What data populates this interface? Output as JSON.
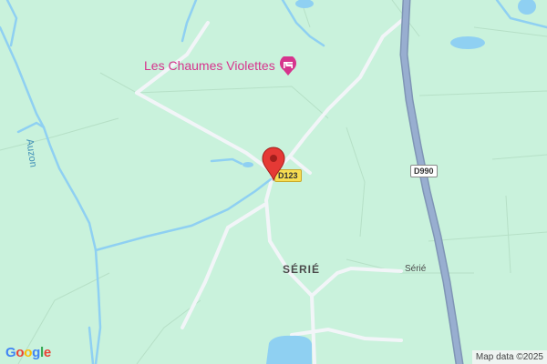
{
  "map": {
    "poi": {
      "name": "Les Chaumes Violettes",
      "icon": "hotel-bed-icon",
      "color": "#d6348d"
    },
    "places": {
      "village": "SÉRIÉ",
      "hamlet": "Sérié"
    },
    "river": {
      "name": "Auzon"
    },
    "roads": {
      "main_shield": "D990",
      "local_shield": "D123"
    },
    "marker": {
      "icon": "map-pin-icon",
      "color": "#e53935"
    },
    "logo": {
      "letters": [
        "G",
        "o",
        "o",
        "g",
        "l",
        "e"
      ]
    },
    "attribution": "Map data ©2025",
    "colors": {
      "land": "#c9f2dc",
      "water": "#8fd0f2",
      "major_road": "#8ca3c4",
      "minor_road": "#e9edf2"
    }
  }
}
